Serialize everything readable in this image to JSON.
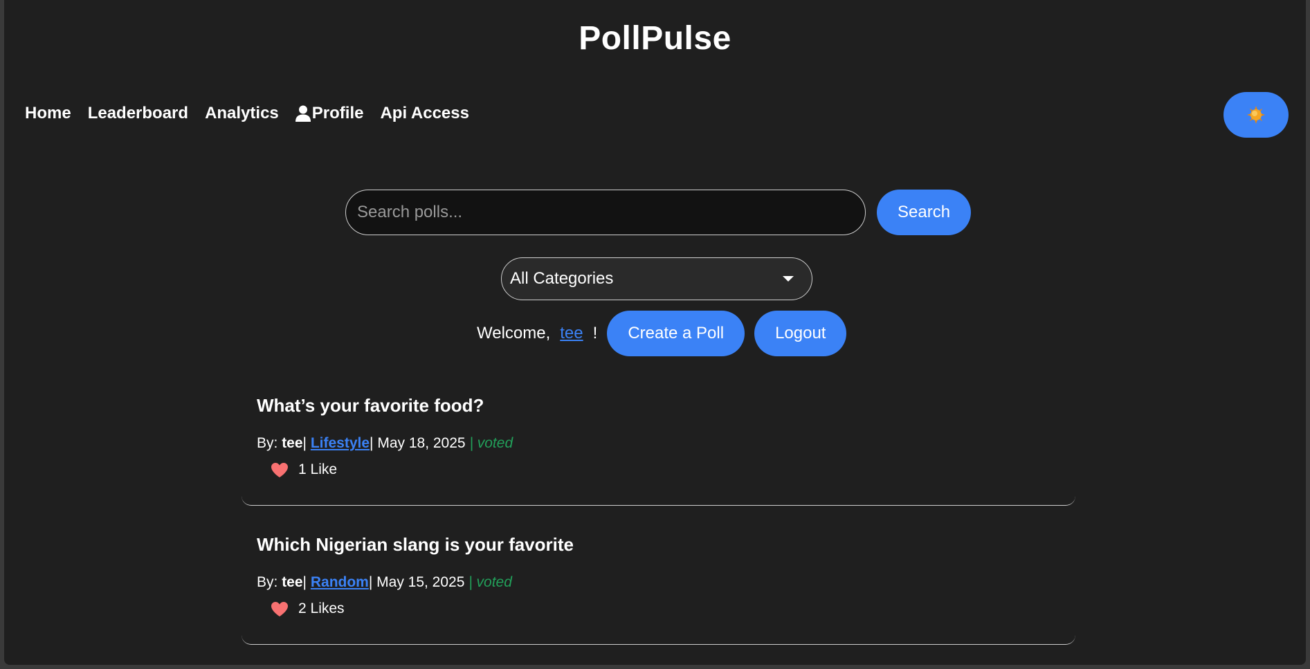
{
  "app": {
    "title": "PollPulse"
  },
  "nav": {
    "items": [
      {
        "label": "Home"
      },
      {
        "label": "Leaderboard"
      },
      {
        "label": "Analytics"
      },
      {
        "label": "Profile",
        "icon": "user-icon"
      },
      {
        "label": "Api Access"
      }
    ],
    "theme_toggle_icon": "sun-icon"
  },
  "search": {
    "placeholder": "Search polls...",
    "value": "",
    "button_label": "Search"
  },
  "filter": {
    "selected": "All Categories"
  },
  "welcome": {
    "prefix": "Welcome,",
    "username": "tee",
    "suffix": "!",
    "create_label": "Create a Poll",
    "logout_label": "Logout"
  },
  "polls": [
    {
      "title": "What’s your favorite food?",
      "by_label": "By:",
      "author": "tee",
      "category": "Lifestyle",
      "date": "May 18, 2025",
      "status": "voted",
      "likes": "1 Like"
    },
    {
      "title": "Which Nigerian slang is your favorite",
      "by_label": "By:",
      "author": "tee",
      "category": "Random",
      "date": "May 15, 2025",
      "status": "voted",
      "likes": "2 Likes"
    }
  ],
  "colors": {
    "accent": "#3b82f6",
    "background": "#1f1f1f",
    "voted": "#22a05a",
    "heart": "#f87171"
  }
}
